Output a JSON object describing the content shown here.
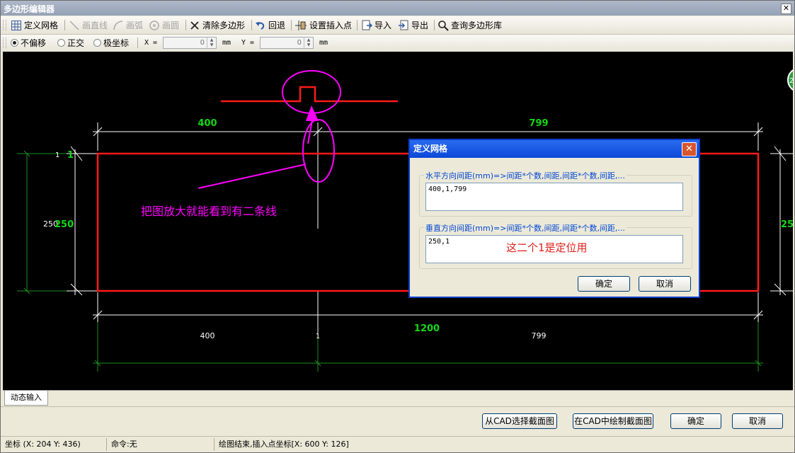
{
  "window": {
    "title": "多边形编辑器",
    "close_glyph": "✕"
  },
  "toolbar": {
    "items": [
      {
        "label": "定义网格",
        "icon": "grid-icon",
        "enabled": true
      },
      {
        "label": "画直线",
        "icon": "line-icon",
        "enabled": false
      },
      {
        "label": "画弧",
        "icon": "arc-icon",
        "enabled": false
      },
      {
        "label": "画圆",
        "icon": "circle-icon",
        "enabled": false
      },
      {
        "label": "清除多边形",
        "icon": "close-icon",
        "enabled": true
      },
      {
        "label": "回退",
        "icon": "undo-icon",
        "enabled": true
      },
      {
        "label": "设置插入点",
        "icon": "insert-point-icon",
        "enabled": true
      },
      {
        "label": "导入",
        "icon": "import-icon",
        "enabled": true
      },
      {
        "label": "导出",
        "icon": "export-icon",
        "enabled": true
      },
      {
        "label": "查询多边形库",
        "icon": "search-icon",
        "enabled": true
      }
    ]
  },
  "offset_options": {
    "selected": "不偏移",
    "options": [
      "不偏移",
      "正交",
      "极坐标"
    ],
    "x_label": "X =",
    "x_value": "0",
    "x_unit": "mm",
    "y_label": "Y =",
    "y_value": "0",
    "y_unit": "mm"
  },
  "canvas": {
    "dim_top_left": "400",
    "dim_top_right": "799",
    "dim_left_small": "1",
    "dim_left_small2": "1",
    "dim_left_250_white": "250",
    "dim_left_250_green": "250",
    "dim_right_partial": "25",
    "dim_bottom_400": "400",
    "dim_bottom_1": "1",
    "dim_bottom_799": "799",
    "dim_total": "1200",
    "annotation": "把图放大就能看到有二条线",
    "right_edge_badge": "2",
    "colors": {
      "outline": "#ff1a1a",
      "annotation": "#ff00ff",
      "dim_green": "#13d813",
      "grid_green": "#1e8f1e"
    }
  },
  "dialog": {
    "title": "定义网格",
    "horizontal": {
      "label": "水平方向间距(mm)=>间距*个数,间距,间距*个数,间距,...",
      "value": "400,1,799"
    },
    "vertical": {
      "label": "垂直方向间距(mm)=>间距*个数,间距,间距*个数,间距,...",
      "value": "250,1"
    },
    "note": "这二个1是定位用",
    "ok": "确定",
    "cancel": "取消"
  },
  "tab": {
    "label": "动态输入"
  },
  "bottom_buttons": {
    "from_cad": "从CAD选择截面图",
    "draw_in_cad": "在CAD中绘制截面图",
    "ok": "确定",
    "cancel": "取消"
  },
  "status": {
    "coords": "坐标 (X: 204 Y: 436)",
    "command": "命令:无",
    "message": "绘图结束,插入点坐标[X: 600 Y: 126]"
  }
}
